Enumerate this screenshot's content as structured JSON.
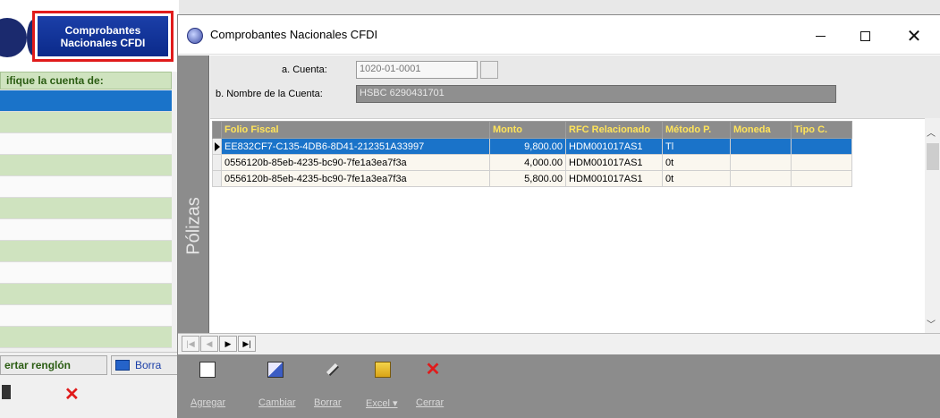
{
  "background_app": {
    "title_button": "Comprobantes\nNacionales CFDI",
    "header_label": "ifique la cuenta de:",
    "insert_button": "ertar renglón",
    "delete_button": "Borra"
  },
  "dialog": {
    "title": "Comprobantes Nacionales CFDI",
    "side_tab": "Pólizas",
    "form": {
      "cuenta_label": "a. Cuenta:",
      "cuenta_value": "1020-01-0001",
      "nombre_label": "b. Nombre de la Cuenta:",
      "nombre_value": "HSBC 6290431701"
    },
    "grid": {
      "headers": [
        "Folio Fiscal",
        "Monto",
        "RFC Relacionado",
        "Método P.",
        "Moneda",
        "Tipo C."
      ],
      "rows": [
        [
          "EE832CF7-C135-4DB6-8D41-212351A33997",
          "9,800.00",
          "HDM001017AS1",
          "Tl",
          "",
          ""
        ],
        [
          "0556120b-85eb-4235-bc90-7fe1a3ea7f3a",
          "4,000.00",
          "HDM001017AS1",
          "0t",
          "",
          ""
        ],
        [
          "0556120b-85eb-4235-bc90-7fe1a3ea7f3a",
          "5,800.00",
          "HDM001017AS1",
          "0t",
          "",
          ""
        ]
      ]
    },
    "toolbar": {
      "agregar": "Agregar",
      "cambiar": "Cambiar",
      "borrar": "Borrar",
      "excel": "Excel ▾",
      "cerrar": "Cerrar"
    }
  },
  "colors": {
    "selection_blue": "#1a73c9",
    "header_yellow": "#ffe45a",
    "panel_gray": "#8c8c8c",
    "highlight_red": "#e01b1b"
  }
}
